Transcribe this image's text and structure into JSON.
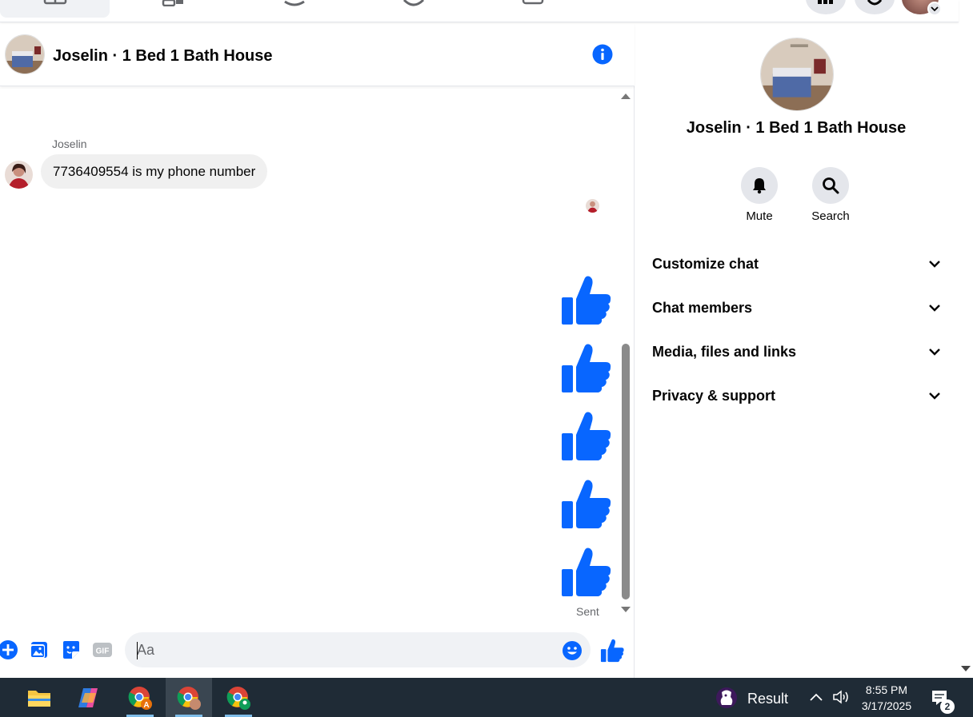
{
  "chat": {
    "title": "Joselin · 1 Bed 1 Bath House",
    "messages": [
      {
        "sender": "Joselin",
        "text": "7736409554 is my phone number"
      }
    ],
    "like_count": 5,
    "status": "Sent"
  },
  "composer": {
    "placeholder": "Aa"
  },
  "sidebar": {
    "title": "Joselin · 1 Bed 1 Bath House",
    "actions": [
      {
        "label": "Mute",
        "icon": "bell-icon"
      },
      {
        "label": "Search",
        "icon": "search-icon"
      }
    ],
    "sections": [
      {
        "label": "Customize chat"
      },
      {
        "label": "Chat members"
      },
      {
        "label": "Media, files and links"
      },
      {
        "label": "Privacy & support"
      }
    ]
  },
  "taskbar": {
    "result_label": "Result",
    "time": "8:55 PM",
    "date": "3/17/2025",
    "notification_count": "2"
  },
  "colors": {
    "accent": "#0866ff",
    "taskbar": "#1f2b36"
  }
}
